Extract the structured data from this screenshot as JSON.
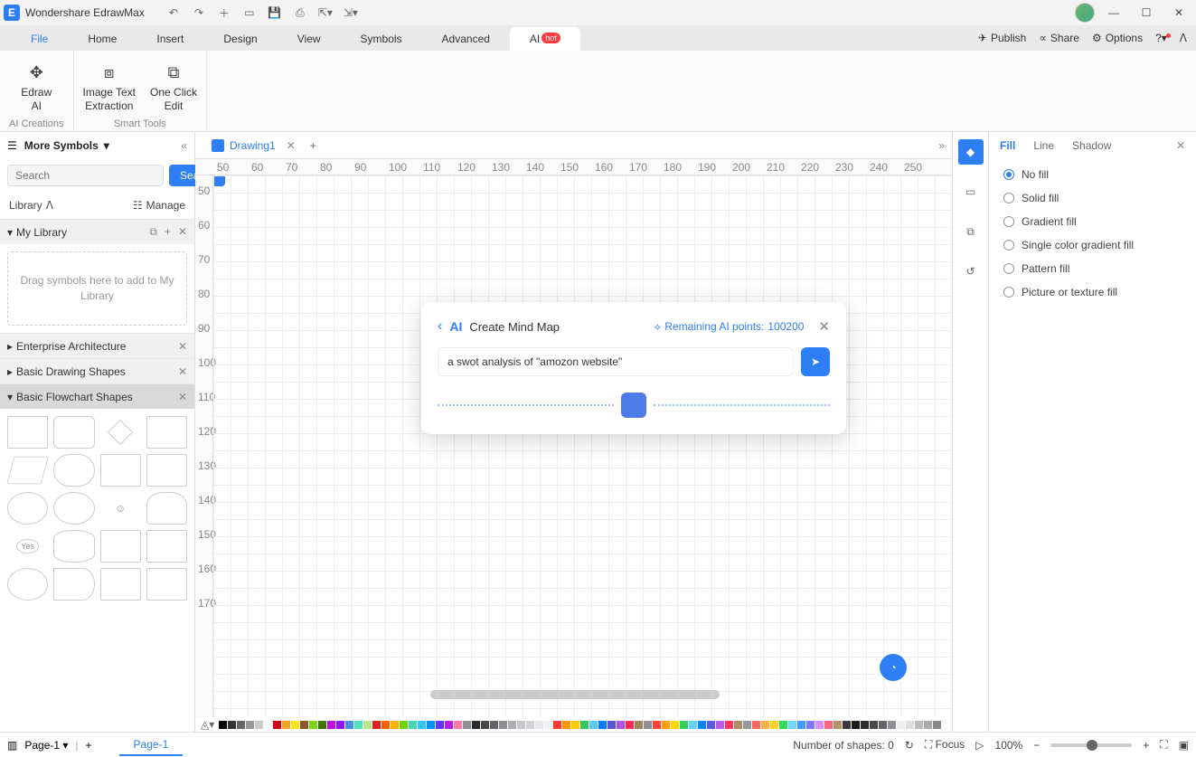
{
  "app": {
    "title": "Wondershare EdrawMax"
  },
  "menus": [
    "File",
    "Home",
    "Insert",
    "Design",
    "View",
    "Symbols",
    "Advanced",
    "AI"
  ],
  "menu_right": {
    "publish": "Publish",
    "share": "Share",
    "options": "Options"
  },
  "ribbon": {
    "group1_label": "AI Creations",
    "group2_label": "Smart Tools",
    "btn_ai": "Edraw\nAI",
    "btn_img": "Image Text\nExtraction",
    "btn_oneclick": "One Click\nEdit"
  },
  "sidebar": {
    "more_symbols": "More Symbols",
    "search_placeholder": "Search",
    "search_btn": "Search",
    "library": "Library",
    "manage": "Manage",
    "mylib": "My Library",
    "mylib_hint": "Drag symbols here to add to My Library",
    "sections": [
      "Enterprise Architecture",
      "Basic Drawing Shapes",
      "Basic Flowchart Shapes"
    ]
  },
  "doc": {
    "tab": "Drawing1"
  },
  "ruler_h": [
    "50",
    "60",
    "70",
    "80",
    "90",
    "100",
    "110",
    "120",
    "130",
    "140",
    "150",
    "160",
    "170",
    "180",
    "190",
    "200",
    "210",
    "220",
    "230",
    "240",
    "250"
  ],
  "ruler_v": [
    "50",
    "60",
    "70",
    "80",
    "90",
    "100",
    "110",
    "120",
    "130",
    "140",
    "150",
    "160",
    "170"
  ],
  "ai_dialog": {
    "title": "Create Mind Map",
    "points_label": "Remaining AI points: ",
    "points": "100200",
    "input": "a swot analysis of \"amozon website\""
  },
  "right_panel": {
    "tabs": [
      "Fill",
      "Line",
      "Shadow"
    ],
    "options": [
      "No fill",
      "Solid fill",
      "Gradient fill",
      "Single color gradient fill",
      "Pattern fill",
      "Picture or texture fill"
    ]
  },
  "status": {
    "page_sel": "Page-1",
    "page_tab": "Page-1",
    "shapes": "Number of shapes: 0",
    "focus": "Focus",
    "zoom": "100%"
  },
  "palette_colors": [
    "#000",
    "#333",
    "#666",
    "#999",
    "#ccc",
    "#fff",
    "#d0021b",
    "#f5a623",
    "#f8e71c",
    "#8b572a",
    "#7ed321",
    "#417505",
    "#bd10e0",
    "#9013fe",
    "#4a90e2",
    "#50e3c2",
    "#b8e986",
    "#e02020",
    "#fa6400",
    "#f7b500",
    "#6dd400",
    "#44d7b6",
    "#32c5ff",
    "#0091ff",
    "#6236ff",
    "#b620e0",
    "#ff7bac",
    "#8e8e93",
    "#2c2c2e",
    "#48484a",
    "#636366",
    "#8e8e93",
    "#aeaeb2",
    "#c7c7cc",
    "#d1d1d6",
    "#e5e5ea",
    "#f2f2f7",
    "#ff3b30",
    "#ff9500",
    "#ffcc00",
    "#34c759",
    "#5ac8fa",
    "#007aff",
    "#5856d6",
    "#af52de",
    "#ff2d55",
    "#a2845e",
    "#8e8e93",
    "#ff453a",
    "#ff9f0a",
    "#ffd60a",
    "#30d158",
    "#64d2ff",
    "#0a84ff",
    "#5e5ce6",
    "#bf5af2",
    "#ff375f",
    "#ac8e68",
    "#98989d",
    "#ff6961",
    "#ffb340",
    "#ffd426",
    "#30db5b",
    "#70d7ff",
    "#409cff",
    "#7d7aff",
    "#da8fff",
    "#ff6482",
    "#b59469",
    "#3a3a3c",
    "#1c1c1e",
    "#2c2c2e",
    "#48484a",
    "#636366",
    "#8e8e93",
    "#eee",
    "#ddd",
    "#bbb",
    "#aaa",
    "#888"
  ]
}
